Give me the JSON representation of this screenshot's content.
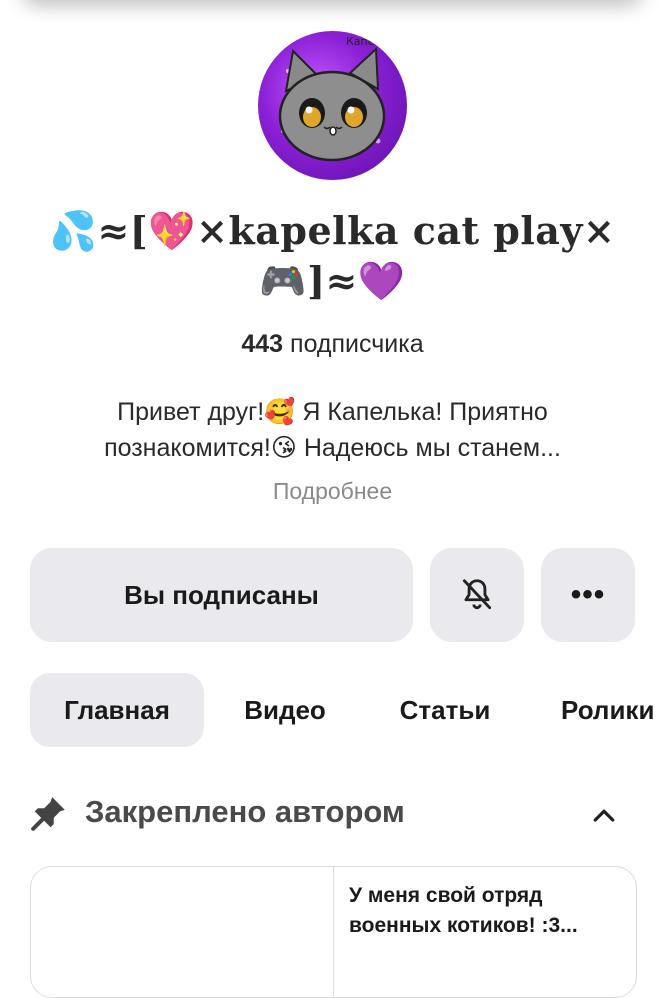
{
  "channel": {
    "name_line1": "💦≈[💖×kapelka cat play×",
    "name_line2": "🎮]≈💜",
    "avatar_caption": "Капелька",
    "subscribers_count": "443",
    "subscribers_label": "подписчика",
    "about_line1": "Привет друг!🥰 Я Капелька! Приятно",
    "about_line2": "познакомится!😘 Надеюсь мы станем...",
    "more_link": "Подробнее"
  },
  "actions": {
    "subscribed_label": "Вы подписаны",
    "bell_icon": "bell-off-icon",
    "more_icon": "more-dots-icon",
    "more_text": "•••"
  },
  "tabs": [
    {
      "label": "Главная",
      "active": true
    },
    {
      "label": "Видео",
      "active": false
    },
    {
      "label": "Статьи",
      "active": false
    },
    {
      "label": "Ролики",
      "active": false
    }
  ],
  "pinned": {
    "title": "Закреплено автором",
    "pin_icon": "pin-icon",
    "collapse_icon": "chevron-up-icon",
    "card_text": "У меня свой отряд военных котиков! :3..."
  },
  "colors": {
    "button_bg": "#e9e9ee",
    "muted_text": "#8a8a8a",
    "avatar_purple": "#8b1fd6"
  }
}
